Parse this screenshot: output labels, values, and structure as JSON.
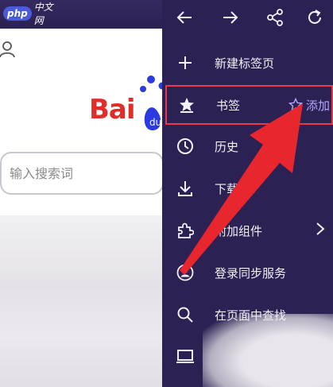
{
  "watermark": {
    "php": "php",
    "site": "中文网"
  },
  "page": {
    "logo_text": "Bai",
    "search_placeholder": "输入搜索词"
  },
  "menu": {
    "items": [
      {
        "label": "新建标签页",
        "icon": "plus-icon"
      },
      {
        "label": "书签",
        "icon": "star-bookmark-icon",
        "action_label": "添加"
      },
      {
        "label": "历史",
        "icon": "clock-icon"
      },
      {
        "label": "下载",
        "icon": "download-icon"
      },
      {
        "label": "附加组件",
        "icon": "puzzle-icon"
      },
      {
        "label": "登录同步服务",
        "icon": "account-icon"
      },
      {
        "label": "在页面中查找",
        "icon": "search-icon"
      },
      {
        "label": "",
        "icon": "desktop-icon"
      }
    ]
  },
  "colors": {
    "menu_bg": "#2b2152",
    "highlight_border": "#e53a4a",
    "arrow": "#e8262d",
    "accent_add": "#b9a6ff",
    "baidu_red": "#de2e2a",
    "baidu_blue": "#2b3be0"
  }
}
